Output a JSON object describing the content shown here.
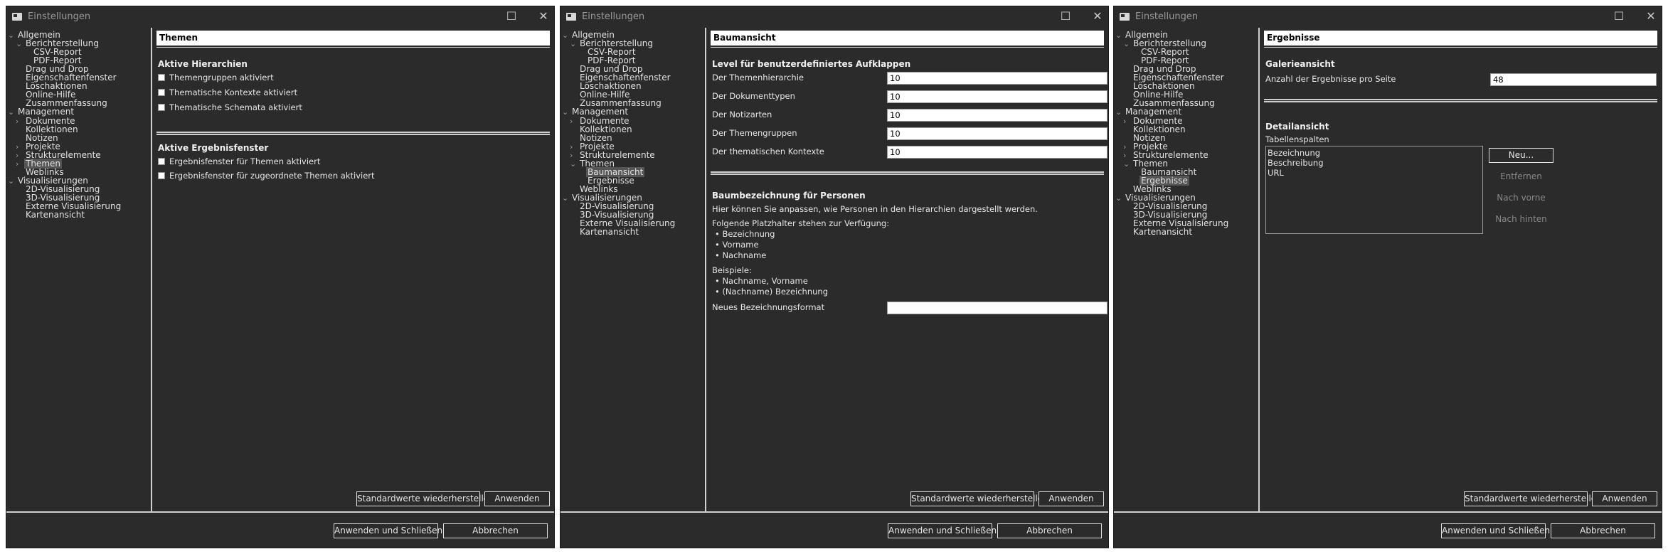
{
  "window_title": "Einstellungen",
  "controls": {
    "maximize": "☐",
    "close": "✕"
  },
  "tree1": [
    {
      "label": "Allgemein",
      "arrow": "⌄"
    },
    {
      "label": "Berichterstellung",
      "arrow": "⌄"
    },
    {
      "label": "CSV-Report",
      "arrow": ""
    },
    {
      "label": "PDF-Report",
      "arrow": ""
    },
    {
      "label": "Drag und Drop",
      "arrow": ""
    },
    {
      "label": "Eigenschaftenfenster",
      "arrow": ""
    },
    {
      "label": "Löschaktionen",
      "arrow": ""
    },
    {
      "label": "Online-Hilfe",
      "arrow": ""
    },
    {
      "label": "Zusammenfassung",
      "arrow": ""
    },
    {
      "label": "Management",
      "arrow": "⌄"
    },
    {
      "label": "Dokumente",
      "arrow": "›"
    },
    {
      "label": "Kollektionen",
      "arrow": ""
    },
    {
      "label": "Notizen",
      "arrow": ""
    },
    {
      "label": "Projekte",
      "arrow": "›"
    },
    {
      "label": "Strukturelemente",
      "arrow": "›"
    },
    {
      "label": "Themen",
      "arrow": "›"
    },
    {
      "label": "Weblinks",
      "arrow": ""
    },
    {
      "label": "Visualisierungen",
      "arrow": "⌄"
    },
    {
      "label": "2D-Visualisierung",
      "arrow": ""
    },
    {
      "label": "3D-Visualisierung",
      "arrow": ""
    },
    {
      "label": "Externe Visualisierung",
      "arrow": ""
    },
    {
      "label": "Kartenansicht",
      "arrow": ""
    }
  ],
  "tree2": [
    {
      "label": "Allgemein",
      "arrow": "⌄"
    },
    {
      "label": "Berichterstellung",
      "arrow": "⌄"
    },
    {
      "label": "CSV-Report",
      "arrow": ""
    },
    {
      "label": "PDF-Report",
      "arrow": ""
    },
    {
      "label": "Drag und Drop",
      "arrow": ""
    },
    {
      "label": "Eigenschaftenfenster",
      "arrow": ""
    },
    {
      "label": "Löschaktionen",
      "arrow": ""
    },
    {
      "label": "Online-Hilfe",
      "arrow": ""
    },
    {
      "label": "Zusammenfassung",
      "arrow": ""
    },
    {
      "label": "Management",
      "arrow": "⌄"
    },
    {
      "label": "Dokumente",
      "arrow": "›"
    },
    {
      "label": "Kollektionen",
      "arrow": ""
    },
    {
      "label": "Notizen",
      "arrow": ""
    },
    {
      "label": "Projekte",
      "arrow": "›"
    },
    {
      "label": "Strukturelemente",
      "arrow": "›"
    },
    {
      "label": "Themen",
      "arrow": "⌄"
    },
    {
      "label": "Baumansicht",
      "arrow": ""
    },
    {
      "label": "Ergebnisse",
      "arrow": ""
    },
    {
      "label": "Weblinks",
      "arrow": ""
    },
    {
      "label": "Visualisierungen",
      "arrow": "⌄"
    },
    {
      "label": "2D-Visualisierung",
      "arrow": ""
    },
    {
      "label": "3D-Visualisierung",
      "arrow": ""
    },
    {
      "label": "Externe Visualisierung",
      "arrow": ""
    },
    {
      "label": "Kartenansicht",
      "arrow": ""
    }
  ],
  "panel1": {
    "header": "Themen",
    "section1": "Aktive Hierarchien",
    "checkboxes1": [
      "Themengruppen aktiviert",
      "Thematische Kontexte aktiviert",
      "Thematische Schemata aktiviert"
    ],
    "section2": "Aktive Ergebnisfenster",
    "checkboxes2": [
      "Ergebnisfenster für Themen aktiviert",
      "Ergebnisfenster für zugeordnete Themen aktiviert"
    ]
  },
  "panel2": {
    "header": "Baumansicht",
    "section1": "Level für benutzerdefiniertes Aufklappen",
    "fields": [
      {
        "label": "Der Themenhierarchie",
        "value": "10"
      },
      {
        "label": "Der Dokumenttypen",
        "value": "10"
      },
      {
        "label": "Der Notizarten",
        "value": "10"
      },
      {
        "label": "Der Themengruppen",
        "value": "10"
      },
      {
        "label": "Der thematischen Kontexte",
        "value": "10"
      }
    ],
    "section2": "Baumbezeichnung für Personen",
    "intro": "Hier können Sie anpassen, wie Personen in den Hierarchien dargestellt werden.",
    "placeholders_title": "Folgende Platzhalter stehen zur Verfügung:",
    "placeholders": [
      "• Bezeichnung",
      "• Vorname",
      "• Nachname"
    ],
    "examples_title": "Beispiele:",
    "examples": [
      "• Nachname, Vorname",
      "• (Nachname) Bezeichnung"
    ],
    "format_label": "Neues Bezeichnungsformat",
    "format_value": ""
  },
  "panel3": {
    "header": "Ergebnisse",
    "section1": "Galerieansicht",
    "count_label": "Anzahl der Ergebnisse pro Seite",
    "count_value": "48",
    "section2": "Detailansicht",
    "columns_label": "Tabellenspalten",
    "columns": [
      "Bezeichnung",
      "Beschreibung",
      "URL"
    ],
    "btn_new": "Neu...",
    "btn_remove": "Entfernen",
    "btn_up": "Nach vorne",
    "btn_down": "Nach hinten"
  },
  "buttons": {
    "restore": "Standardwerte wiederherstellen",
    "apply": "Anwenden",
    "apply_close": "Anwenden und Schließen",
    "cancel": "Abbrechen"
  }
}
